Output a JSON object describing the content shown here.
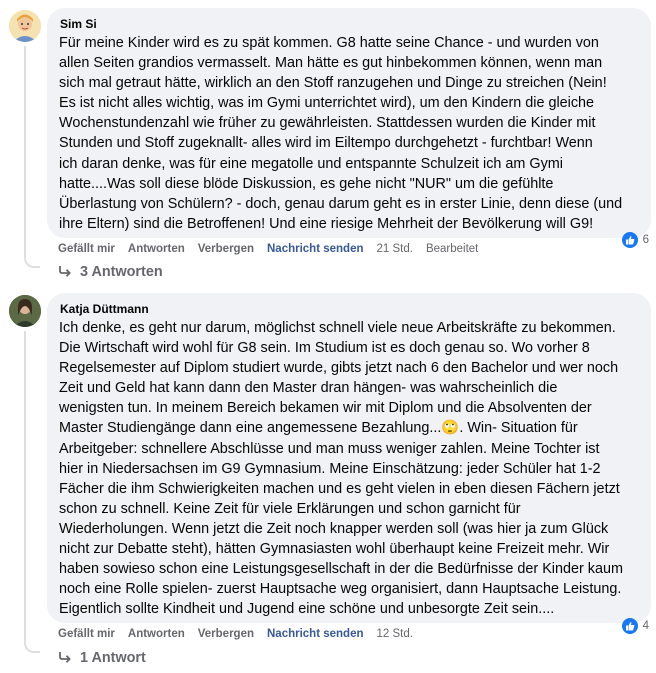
{
  "comments": [
    {
      "author": "Sim Si",
      "lines": [
        "Für meine Kinder wird es zu spät kommen. G8 hatte seine Chance - und wurden von",
        "allen Seiten grandios vermasselt. Man hätte es gut hinbekommen können, wenn man",
        "sich mal getraut hätte, wirklich an den Stoff ranzugehen und Dinge zu streichen (Nein!",
        "Es ist nicht alles wichtig, was im Gymi unterrichtet wird), um den Kindern die gleiche",
        "Wochenstundenzahl wie früher zu gewährleisten. Stattdessen wurden die Kinder mit",
        "Stunden und Stoff zugeknallt- alles wird im Eiltempo durchgehetzt - furchtbar! Wenn",
        "ich daran denke, was für eine megatolle und entspannte Schulzeit ich am Gymi",
        "hatte....Was soll diese blöde Diskussion, es gehe nicht \"NUR\" um die gefühlte",
        "Überlastung von Schülern? - doch, genau darum geht es in erster Linie, denn diese (und",
        "ihre Eltern) sind die Betroffenen! Und eine riesige Mehrheit der Bevölkerung will G9!"
      ],
      "actions": {
        "like": "Gefällt mir",
        "reply": "Antworten",
        "hide": "Verbergen",
        "message": "Nachricht senden",
        "time": "21 Std.",
        "edited": "Bearbeitet"
      },
      "reaction_count": "6",
      "replies_label": "3 Antworten"
    },
    {
      "author": "Katja Düttmann",
      "lines": [
        "Ich denke, es geht nur darum, möglichst schnell viele neue Arbeitskräfte zu bekommen.",
        "Die Wirtschaft wird wohl für G8 sein. Im Studium ist es doch genau so. Wo vorher 8",
        "Regelsemester auf Diplom studiert wurde, gibts jetzt nach 6 den Bachelor und wer noch",
        "Zeit und Geld hat kann dann den Master dran hängen- was wahrscheinlich die",
        "wenigsten tun. In meinem Bereich bekamen wir mit Diplom und die Absolventen der",
        "Master Studiengänge dann eine angemessene Bezahlung...🙄. Win- Situation für",
        "Arbeitgeber: schnellere Abschlüsse und man muss weniger zahlen. Meine Tochter ist",
        "hier in Niedersachsen im G9 Gymnasium. Meine Einschätzung: jeder Schüler hat 1-2",
        "Fächer die ihm Schwierigkeiten machen und es geht vielen in eben diesen Fächern jetzt",
        "schon zu schnell. Keine Zeit für viele Erklärungen und schon garnicht für",
        "Wiederholungen. Wenn jetzt die Zeit noch knapper werden soll (was hier ja zum Glück",
        "nicht zur Debatte steht), hätten Gymnasiasten wohl überhaupt keine Freizeit mehr. Wir",
        "haben sowieso schon eine Leistungsgesellschaft in der die Bedürfnisse der Kinder kaum",
        "noch eine Rolle spielen- zuerst Hauptsache weg organisiert, dann Hauptsache Leistung.",
        "Eigentlich sollte Kindheit und Jugend eine schöne und unbesorgte Zeit sein...."
      ],
      "actions": {
        "like": "Gefällt mir",
        "reply": "Antworten",
        "hide": "Verbergen",
        "message": "Nachricht senden",
        "time": "12 Std."
      },
      "reaction_count": "4",
      "replies_label": "1 Antwort"
    }
  ],
  "colors": {
    "bubble": "#f0f2f5",
    "text": "#050505",
    "muted": "#65676b",
    "link": "#385898",
    "like_blue": "#1877f2"
  }
}
